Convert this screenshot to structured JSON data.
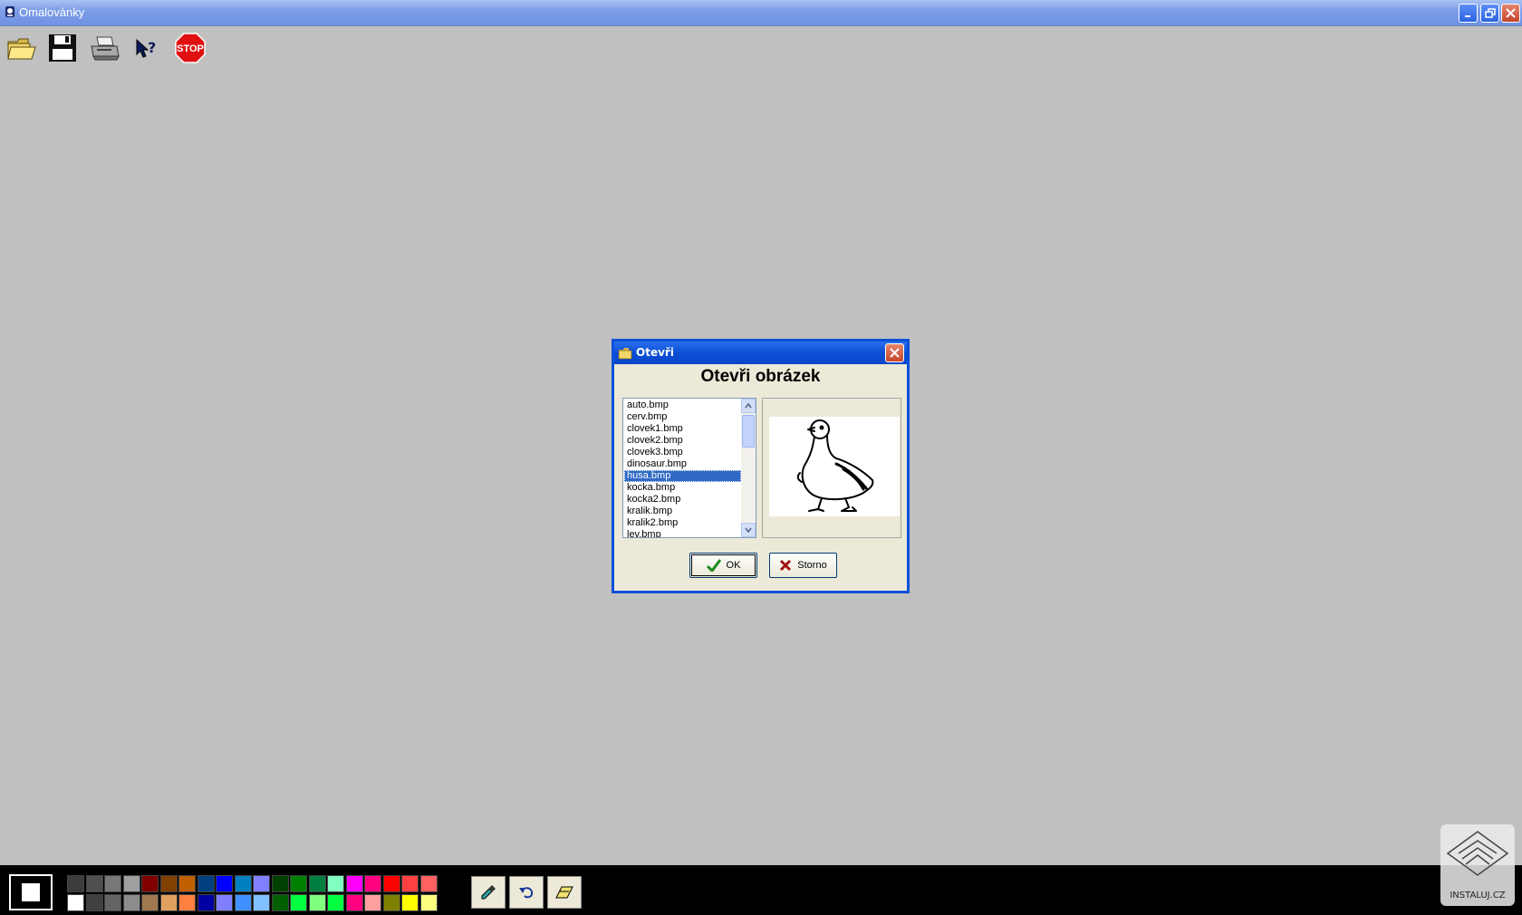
{
  "window": {
    "title": "Omalovánky",
    "controls": [
      "minimize-icon",
      "restore-icon",
      "close-icon"
    ]
  },
  "toolbar": {
    "buttons": [
      {
        "name": "open",
        "icon": "folder-open-icon"
      },
      {
        "name": "save",
        "icon": "floppy-disk-icon"
      },
      {
        "name": "print",
        "icon": "printer-icon"
      },
      {
        "name": "help",
        "icon": "help-cursor-icon"
      },
      {
        "name": "exit",
        "icon": "stop-sign-icon",
        "label": "STOP"
      }
    ]
  },
  "dialog": {
    "title": "Otevři",
    "heading": "Otevři obrázek",
    "files": [
      "auto.bmp",
      "cerv.bmp",
      "clovek1.bmp",
      "clovek2.bmp",
      "clovek3.bmp",
      "dinosaur.bmp",
      "husa.bmp",
      "kocka.bmp",
      "kocka2.bmp",
      "kralik.bmp",
      "kralik2.bmp",
      "lev.bmp"
    ],
    "selected_file": "husa.bmp",
    "preview_icon": "goose-drawing",
    "ok_label": "OK",
    "cancel_label": "Storno"
  },
  "palette": {
    "current_color": "#ffffff",
    "row1": [
      "#3c3c3c",
      "#505050",
      "#787878",
      "#a0a0a0",
      "#800000",
      "#804000",
      "#c06000",
      "#004080",
      "#0000ff",
      "#0080c0",
      "#8080ff",
      "#004000",
      "#008000",
      "#008040",
      "#80ffc0",
      "#ff00ff",
      "#ff0080",
      "#ff0000",
      "#ff4040",
      "#ff6060"
    ],
    "row2": [
      "#ffffff",
      "#404040",
      "#646464",
      "#8c8c8c",
      "#a07850",
      "#e0a060",
      "#ff8040",
      "#0000a0",
      "#8080ff",
      "#4090ff",
      "#80c0ff",
      "#006000",
      "#00ff40",
      "#80ff80",
      "#00ff40",
      "#ff0080",
      "#ffa0a0",
      "#808000",
      "#ffff00",
      "#ffff80"
    ],
    "tools": [
      "eyedropper-icon",
      "undo-icon",
      "eraser-icon"
    ]
  },
  "watermark": {
    "text": "INSTALUJ.CZ"
  }
}
